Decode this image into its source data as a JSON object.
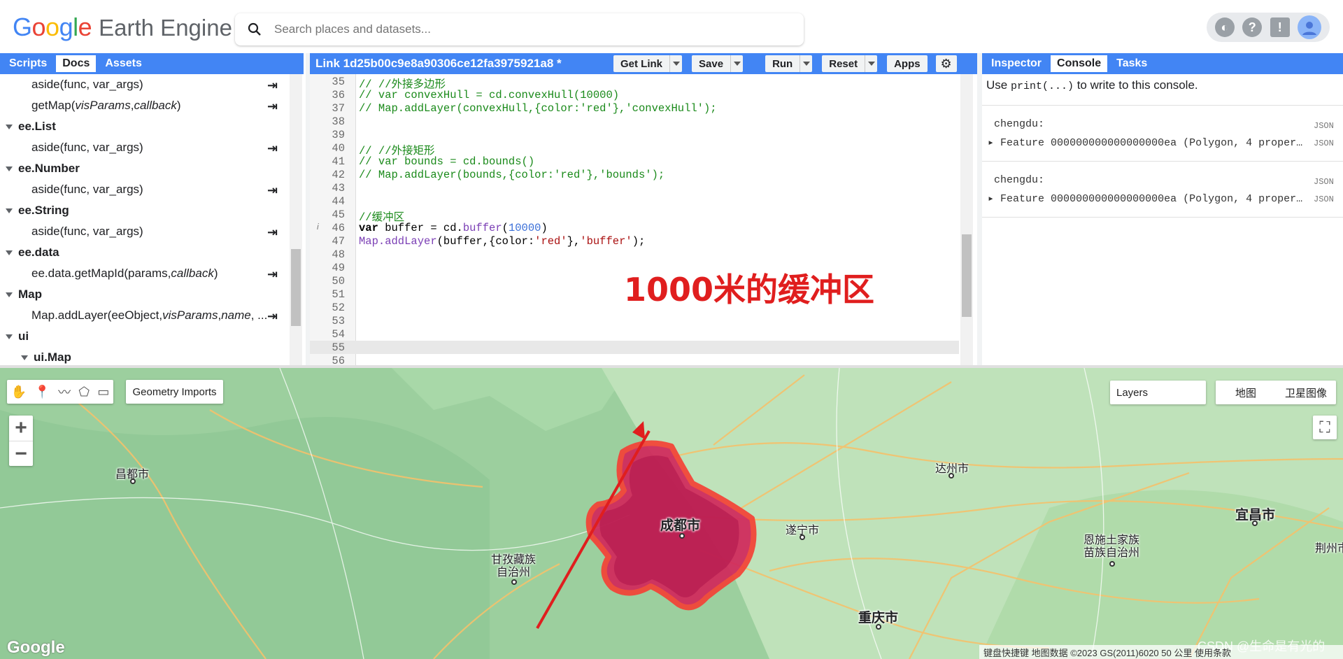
{
  "header": {
    "logo_google": "Google",
    "logo_product": "Earth Engine",
    "search_placeholder": "Search places and datasets..."
  },
  "left_panel": {
    "tabs": [
      {
        "label": "Scripts"
      },
      {
        "label": "Docs"
      },
      {
        "label": "Assets"
      }
    ],
    "active_tab": "Docs",
    "docs": [
      {
        "type": "item",
        "text": "aside(func, var_args)"
      },
      {
        "type": "item",
        "text_plain": "getMap(",
        "text_italic": "visParams",
        "text_mid": ", ",
        "text_italic2": "callback",
        "text_end": ")"
      },
      {
        "type": "group",
        "text": "ee.List"
      },
      {
        "type": "item",
        "text": "aside(func, var_args)"
      },
      {
        "type": "group",
        "text": "ee.Number"
      },
      {
        "type": "item",
        "text": "aside(func, var_args)"
      },
      {
        "type": "group",
        "text": "ee.String"
      },
      {
        "type": "item",
        "text": "aside(func, var_args)"
      },
      {
        "type": "group",
        "text": "ee.data"
      },
      {
        "type": "item",
        "text_plain": "ee.data.getMapId(params, ",
        "text_italic": "callback",
        "text_end": ")"
      },
      {
        "type": "group",
        "text": "Map"
      },
      {
        "type": "item",
        "text_plain": "Map.addLayer(eeObject, ",
        "text_italic": "visParams",
        "text_mid": ", ",
        "text_italic2": "name",
        "text_end": ", ..."
      },
      {
        "type": "group",
        "text": "ui"
      },
      {
        "type": "subgroup",
        "text": "ui.Map"
      }
    ]
  },
  "code_editor": {
    "script_title": "Link 1d25b00c9e8a90306ce12fa3975921a8 *",
    "buttons": {
      "get_link": "Get Link",
      "save": "Save",
      "run": "Run",
      "reset": "Reset",
      "apps": "Apps"
    },
    "line_numbers": [
      "35",
      "36",
      "37",
      "38",
      "39",
      "40",
      "41",
      "42",
      "43",
      "44",
      "45",
      "46",
      "47",
      "48",
      "49",
      "50",
      "51",
      "52",
      "53",
      "54",
      "55",
      "56"
    ],
    "lines": {
      "l35": "// //外接多边形",
      "l36": "// var convexHull = cd.convexHull(10000)",
      "l37": "// Map.addLayer(convexHull,{color:'red'},'convexHull');",
      "l40": "// //外接矩形",
      "l41": "// var bounds = cd.bounds()",
      "l42": "// Map.addLayer(bounds,{color:'red'},'bounds');",
      "l45": "//缓冲区",
      "l46_kw": "var",
      "l46_a": " buffer = cd.",
      "l46_fn": "buffer",
      "l46_b": "(",
      "l46_num": "10000",
      "l46_c": ")",
      "l47_fn": "Map.addLayer",
      "l47_a": "(buffer,{color:",
      "l47_s1": "'red'",
      "l47_b": "},",
      "l47_s2": "'buffer'",
      "l47_c": ");"
    },
    "info_marker": "i",
    "annotation": "1000米的缓冲区"
  },
  "right_panel": {
    "tabs": [
      {
        "label": "Inspector"
      },
      {
        "label": "Console"
      },
      {
        "label": "Tasks"
      }
    ],
    "active_tab": "Console",
    "hint_prefix": "Use ",
    "hint_code": "print(...)",
    "hint_suffix": " to write to this console.",
    "entries": [
      {
        "name": "chengdu:",
        "feature": "Feature 000000000000000000ea (Polygon, 4 proper…",
        "json": "JSON"
      },
      {
        "name": "chengdu:",
        "feature": "Feature 000000000000000000ea (Polygon, 4 proper…",
        "json": "JSON"
      }
    ]
  },
  "map": {
    "geometry_imports": "Geometry Imports",
    "layers": "Layers",
    "map_types": [
      "地图",
      "卫星图像"
    ],
    "zoom_in": "+",
    "zoom_out": "−",
    "cities": [
      {
        "name": "成都市",
        "big": true
      },
      {
        "name": "昌都市",
        "big": false
      },
      {
        "name": "达州市",
        "big": false
      },
      {
        "name": "遂宁市",
        "big": false
      },
      {
        "name": "甘孜藏族\n自治州",
        "big": false
      },
      {
        "name": "重庆市",
        "big": true
      },
      {
        "name": "宜昌市",
        "big": true
      },
      {
        "name": "恩施土家族\n苗族自治州",
        "big": false
      },
      {
        "name": "荆州市",
        "big": false
      }
    ],
    "google_logo": "Google",
    "attribution": "键盘快捷键   地图数据 ©2023 GS(2011)6020   50 公里     使用条款",
    "watermark": "CSDN @生命是有光的",
    "buffer_color": "#c2185b",
    "buffer_outline": "#f44336"
  }
}
